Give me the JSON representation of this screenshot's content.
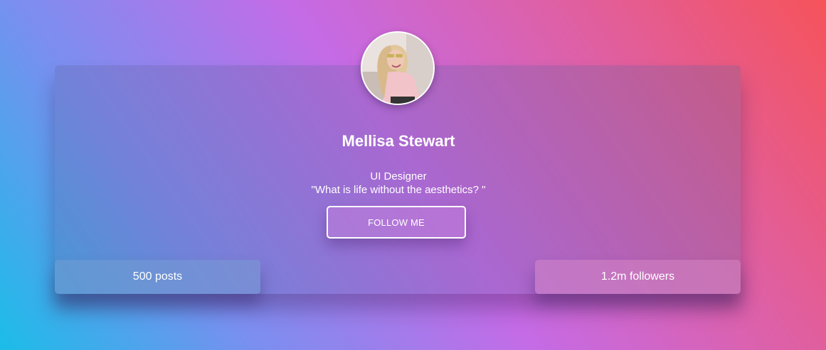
{
  "profile": {
    "name": "Mellisa Stewart",
    "role": "UI Designer",
    "quote": "\"What is life without the aesthetics? \"",
    "follow_label": "FOLLOW ME"
  },
  "stats": {
    "posts": "500 posts",
    "followers": "1.2m followers"
  },
  "colors": {
    "gradient_start": "#1bbde8",
    "gradient_mid": "#c56be6",
    "gradient_end": "#f6535a",
    "text": "#ffffff"
  }
}
